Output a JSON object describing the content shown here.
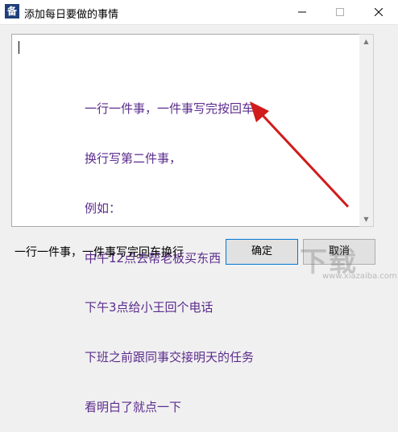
{
  "window": {
    "title": "添加每日要做的事情",
    "icon_glyph": "备",
    "minimize_icon": "minimize-icon",
    "maximize_icon": "maximize-icon",
    "close_icon": "close-icon"
  },
  "editor": {
    "instructions": [
      "一行一件事，一件事写完按回车",
      "换行写第二件事，",
      "例如：",
      "中午12点去帮老板买东西",
      "下午3点给小王回个电话",
      "下班之前跟同事交接明天的任务",
      "看明白了就点一下"
    ],
    "instruction_color": "#5b2c8c"
  },
  "annotation": {
    "arrow_color": "#d11c1c"
  },
  "footer": {
    "hint": "一行一件事，一件事写完回车换行",
    "ok_label": "确定",
    "cancel_label": "取消"
  },
  "watermark": {
    "text": "下载",
    "url": "www.xiazaiba.com"
  }
}
